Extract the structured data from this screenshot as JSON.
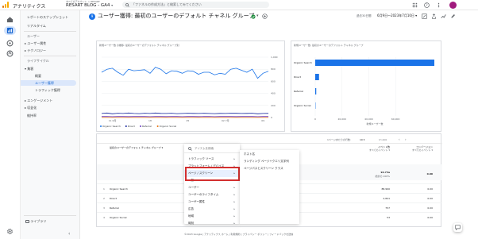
{
  "app": {
    "product": "アナリティクス",
    "account_line": "すべてのアカウント > RESART",
    "property": "RESART BLOG - GA4",
    "search_placeholder": "「ファネルの作成方法」と検索してみてください",
    "date_range": "6月9日〜2023年7月10日",
    "brand_colors": {
      "logo_orange": "#f9ab00",
      "logo_dark": "#e37400",
      "accent_blue": "#1a73e8",
      "avatar": "#a01a7d"
    }
  },
  "sidebar": {
    "items": [
      {
        "label": "レポートのスナップショット"
      },
      {
        "label": "リアルタイム"
      },
      {
        "label": "ユーザー"
      },
      {
        "label": "ユーザー属性"
      },
      {
        "label": "テクノロジー"
      },
      {
        "label": "ライフサイクル"
      },
      {
        "label": "集客"
      },
      {
        "label": "概要"
      },
      {
        "label": "ユーザー獲得"
      },
      {
        "label": "トラフィック獲得"
      },
      {
        "label": "エンゲージメント"
      },
      {
        "label": "収益化"
      },
      {
        "label": "維持率"
      }
    ],
    "library": "ライブラリ"
  },
  "report": {
    "badge": "9",
    "title": "ユーザー獲得: 最初のユーザーのデフォルト チャネル グループ",
    "title_suffix": "▾"
  },
  "line_card": {
    "title": "新規ユーザー数 の推移: 最初のユーザーのデフォルト チャネル グループ別",
    "y_ticks": [
      "1,000",
      "800",
      "600",
      "400",
      "200",
      "0"
    ],
    "x_ticks": [
      "11 6月",
      "18",
      "25",
      "02 7月",
      "09"
    ],
    "legend": [
      "Organic Search",
      "Direct",
      "Referral",
      "Organic Social"
    ]
  },
  "bar_card": {
    "title": "新規ユーザー数: 最初のユーザーのデフォルト チャネル グループ",
    "x_ticks": [
      "0",
      "20,000",
      "40,000",
      "60,000"
    ],
    "axis_label": "新規ユーザー数"
  },
  "chart_data": [
    {
      "type": "line",
      "title": "新規ユーザー数 の推移: 最初のユーザーのデフォルト チャネル グループ別",
      "x": [
        "6/9",
        "6/10",
        "6/11",
        "6/12",
        "6/13",
        "6/14",
        "6/15",
        "6/16",
        "6/17",
        "6/18",
        "6/19",
        "6/20",
        "6/21",
        "6/22",
        "6/23",
        "6/24",
        "6/25",
        "6/26",
        "6/27",
        "6/28",
        "6/29",
        "6/30",
        "7/1",
        "7/2",
        "7/3",
        "7/4",
        "7/5",
        "7/6",
        "7/7",
        "7/8",
        "7/9",
        "7/10"
      ],
      "ylim": [
        0,
        1200
      ],
      "series": [
        {
          "name": "Organic Search",
          "color": "#1a73e8",
          "values": [
            900,
            960,
            980,
            900,
            840,
            960,
            930,
            940,
            950,
            880,
            1000,
            960,
            870,
            930,
            920,
            880,
            930,
            920,
            860,
            900,
            900,
            850,
            880,
            860,
            960,
            980,
            940,
            900,
            960,
            780,
            880,
            920
          ]
        },
        {
          "name": "Direct",
          "color": "#12239e",
          "values": [
            80,
            90,
            75,
            85,
            80,
            90,
            80,
            78,
            85,
            80,
            90,
            82,
            80,
            85,
            78,
            80,
            85,
            82,
            80,
            84,
            80,
            78,
            82,
            80,
            86,
            84,
            80,
            82,
            85,
            75,
            80,
            82
          ]
        },
        {
          "name": "Referral",
          "color": "#6c3fc5",
          "values": [
            20,
            22,
            18,
            20,
            21,
            19,
            20,
            22,
            20,
            18,
            21,
            20,
            19,
            22,
            20,
            18,
            20,
            21,
            19,
            20,
            22,
            18,
            20,
            21,
            20,
            19,
            20,
            21,
            20,
            18,
            20,
            21
          ]
        },
        {
          "name": "Organic Social",
          "color": "#e8710a",
          "values": [
            2,
            1,
            2,
            2,
            1,
            2,
            2,
            1,
            2,
            2,
            1,
            2,
            2,
            1,
            2,
            2,
            1,
            2,
            2,
            1,
            2,
            2,
            1,
            2,
            2,
            1,
            2,
            2,
            1,
            2,
            2,
            1
          ]
        }
      ]
    },
    {
      "type": "bar",
      "title": "新規ユーザー数: 最初のユーザーのデフォルト チャネル グループ",
      "categories": [
        "Organic Search",
        "Direct",
        "Referral",
        "Organic Social"
      ],
      "values": [
        88990,
        2841,
        757,
        53
      ],
      "xlim": [
        0,
        88990
      ]
    }
  ],
  "table": {
    "rows_per_page_label": "1ページあたりの行数:",
    "rows_per_page_value": "10",
    "pagination": "1〜4/4",
    "dimension_header": "最初のユーザーのデフォルト チャネル グループ",
    "event_header": "イベント数",
    "event_sub": "すべてのイベント",
    "conv_header": "コンバージョン",
    "conv_sub": "すべてのイベント",
    "totals": {
      "events": "92.73a",
      "events_sub": "総計の 100%",
      "conv": "0.00"
    },
    "rows": [
      {
        "idx": "1",
        "name": "Organic Search",
        "events": "88,990",
        "conv": "0.00"
      },
      {
        "idx": "2",
        "name": "Direct",
        "events": "2,841",
        "conv": "0.00"
      },
      {
        "idx": "3",
        "name": "Referral",
        "events": "757",
        "conv": "0.00"
      },
      {
        "idx": "4",
        "name": "Organic Social",
        "events": "53",
        "conv": "0.00"
      }
    ]
  },
  "menu1": {
    "search_placeholder": "アイテムを検索",
    "items": [
      "トラフィック ソース",
      "プラットフォーム / デバイス",
      "ページ / スクリーン",
      "一般",
      "ユーザー",
      "ユーザーのライフタイム",
      "ユーザー属性",
      "広告",
      "地域",
      "時刻"
    ]
  },
  "menu2": {
    "items": [
      "ホスト名",
      "ランディング ページ＋クエリ文字列",
      "ページパスとスクリーン クラス"
    ]
  },
  "footer": "©2023 Google | アナリティクス ホーム | 利用規約 | プライバシー ポリシー | フィードバックを送信"
}
